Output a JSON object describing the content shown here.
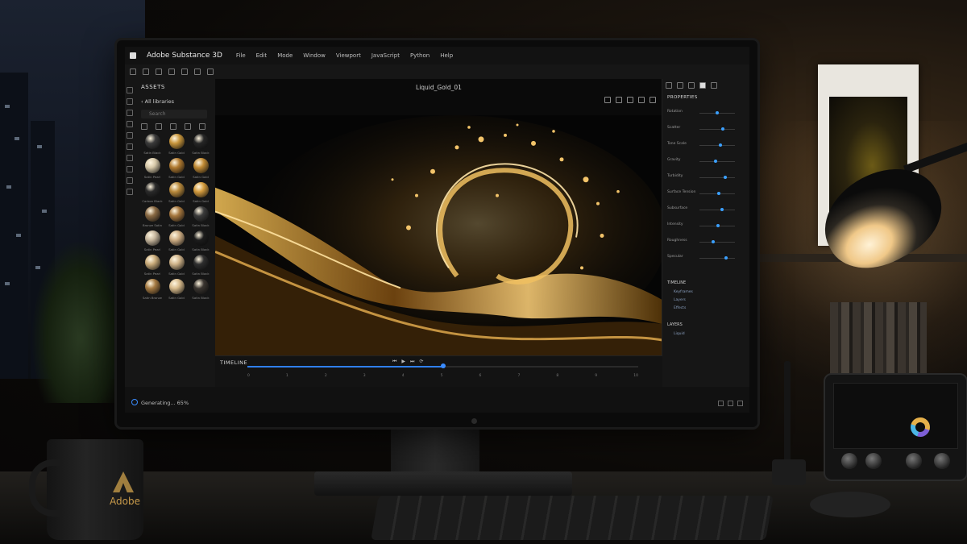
{
  "app": {
    "title": "Adobe Substance 3D",
    "menu": [
      "File",
      "Edit",
      "Mode",
      "Window",
      "Viewport",
      "JavaScript",
      "Python",
      "Help"
    ]
  },
  "assets": {
    "title": "ASSETS",
    "library": "‹ All libraries",
    "search_placeholder": "Search",
    "swatches": [
      {
        "color": "#3a3a3a",
        "label": "Satin Black"
      },
      {
        "color": "#c8963c",
        "label": "Satin Gold"
      },
      {
        "color": "#262626",
        "label": "Satin Black"
      },
      {
        "color": "#d6c8a8",
        "label": "Satin Pearl"
      },
      {
        "color": "#b07a30",
        "label": "Satin Gold"
      },
      {
        "color": "#c08a34",
        "label": "Satin Gold"
      },
      {
        "color": "#2a2a2a",
        "label": "Carbon Black"
      },
      {
        "color": "#b98a3c",
        "label": "Satin Gold"
      },
      {
        "color": "#d49c3e",
        "label": "Satin Gold"
      },
      {
        "color": "#8a6a44",
        "label": "Bronze Satin"
      },
      {
        "color": "#a6773e",
        "label": "Satin Gold"
      },
      {
        "color": "#3b3b3b",
        "label": "Satin Black"
      },
      {
        "color": "#c7b79e",
        "label": "Satin Pearl"
      },
      {
        "color": "#cfae84",
        "label": "Satin Gold"
      },
      {
        "color": "#1c1c1c",
        "label": "Satin Black"
      },
      {
        "color": "#c9ab7a",
        "label": "Satin Pearl"
      },
      {
        "color": "#d0b48a",
        "label": "Satin Gold"
      },
      {
        "color": "#2e2e2e",
        "label": "Satin Black"
      },
      {
        "color": "#a57a42",
        "label": "Satin Bronze"
      },
      {
        "color": "#d8bb8c",
        "label": "Satin Gold"
      },
      {
        "color": "#3a3530",
        "label": "Satin Black"
      }
    ]
  },
  "viewport": {
    "title": "Liquid_Gold_01"
  },
  "properties": {
    "title": "PROPERTIES",
    "rows": [
      {
        "label": "Rotation",
        "value": 0.45
      },
      {
        "label": "Scatter",
        "value": 0.62
      },
      {
        "label": "Tone Scale",
        "value": 0.55
      },
      {
        "label": "Gravity",
        "value": 0.4
      },
      {
        "label": "Turbidity",
        "value": 0.68
      },
      {
        "label": "Surface Tension",
        "value": 0.5
      },
      {
        "label": "Subsurface",
        "value": 0.58
      },
      {
        "label": "Intensity",
        "value": 0.48
      },
      {
        "label": "Roughness",
        "value": 0.35
      },
      {
        "label": "Specular",
        "value": 0.7
      }
    ]
  },
  "timeline_panel": {
    "title": "TIMELINE",
    "items": [
      "Keyframes",
      "Layers",
      "Effects"
    ]
  },
  "layers_panel": {
    "title": "LAYERS",
    "items": [
      "Liquid"
    ]
  },
  "timeline": {
    "label": "TIMELINE",
    "progress": 0.5,
    "ticks": [
      "0",
      "1",
      "2",
      "3",
      "4",
      "5",
      "6",
      "7",
      "8",
      "9",
      "10"
    ]
  },
  "status": {
    "text": "Generating... 65%"
  },
  "mug": {
    "brand": "Adobe"
  }
}
